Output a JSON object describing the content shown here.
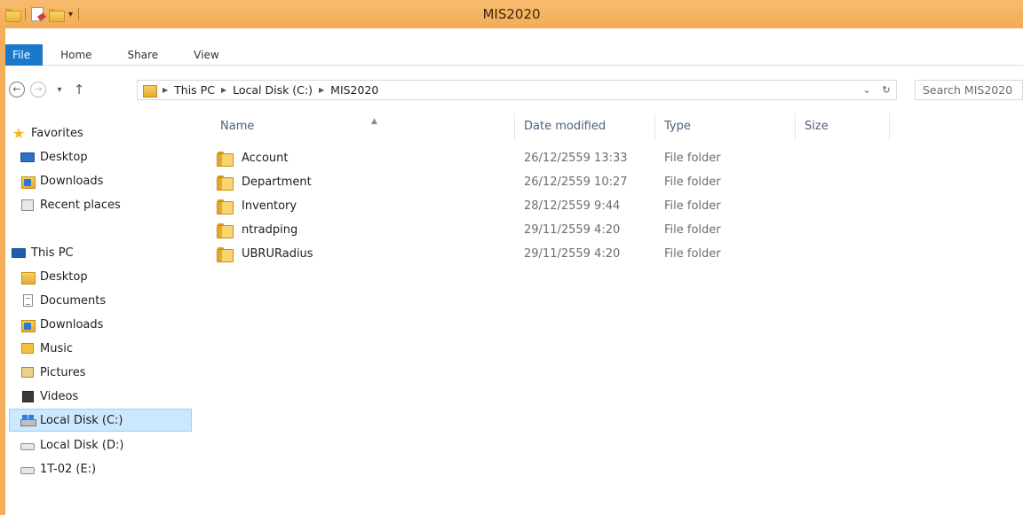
{
  "window": {
    "title": "MIS2020"
  },
  "ribbon": {
    "tabs": [
      {
        "label": "File"
      },
      {
        "label": "Home"
      },
      {
        "label": "Share"
      },
      {
        "label": "View"
      }
    ]
  },
  "nav": {
    "back_glyph": "←",
    "forward_glyph": "→",
    "recent_glyph": "▾",
    "up_glyph": "↑",
    "breadcrumb": [
      "This PC",
      "Local Disk (C:)",
      "MIS2020"
    ],
    "dropdown_glyph": "⌄",
    "refresh_glyph": "↻",
    "search_placeholder": "Search MIS2020"
  },
  "sidebar": {
    "favorites_label": "Favorites",
    "favorites": [
      "Desktop",
      "Downloads",
      "Recent places"
    ],
    "thispc_label": "This PC",
    "thispc": [
      "Desktop",
      "Documents",
      "Downloads",
      "Music",
      "Pictures",
      "Videos",
      "Local Disk (C:)",
      "Local Disk (D:)",
      "1T-02 (E:)"
    ],
    "selected": "Local Disk (C:)"
  },
  "columns": {
    "name": "Name",
    "date": "Date modified",
    "type": "Type",
    "size": "Size"
  },
  "files": [
    {
      "name": "Account",
      "date": "26/12/2559 13:33",
      "type": "File folder"
    },
    {
      "name": "Department",
      "date": "26/12/2559 10:27",
      "type": "File folder"
    },
    {
      "name": "Inventory",
      "date": "28/12/2559 9:44",
      "type": "File folder"
    },
    {
      "name": "ntradping",
      "date": "29/11/2559 4:20",
      "type": "File folder"
    },
    {
      "name": "UBRURadius",
      "date": "29/11/2559 4:20",
      "type": "File folder"
    }
  ],
  "colors": {
    "titlebar": "#f3ac58",
    "file_tab": "#1979ca",
    "selection": "#cce8ff"
  }
}
